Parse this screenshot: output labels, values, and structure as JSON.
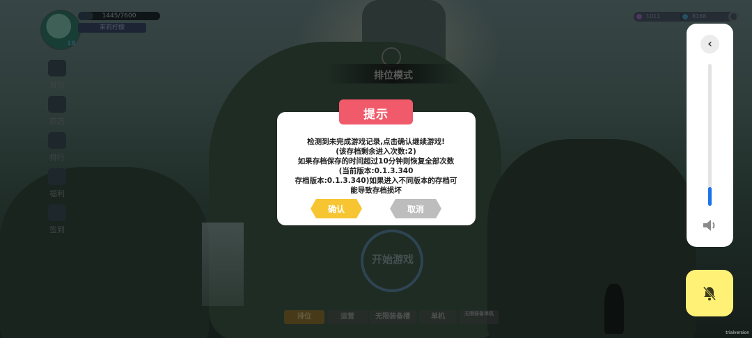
{
  "hud": {
    "hp_text": "1445/7600",
    "hp_fraction": 0.19,
    "player_name": "茉莉柠檬",
    "level": "18",
    "currency_1": "1011",
    "currency_2": "8168"
  },
  "side_menu": [
    {
      "label": "背包"
    },
    {
      "label": "商店"
    },
    {
      "label": "排行"
    },
    {
      "label": "福利"
    },
    {
      "label": "签到"
    }
  ],
  "mode_title": "排位模式",
  "start_label": "开始游戏",
  "tabs": [
    {
      "label": "排位",
      "active": true
    },
    {
      "label": "运营"
    },
    {
      "label": "无限装备槽"
    },
    {
      "label": "单机"
    },
    {
      "label": "无限装备单机"
    }
  ],
  "trial_text": "trialversion",
  "dialog": {
    "title": "提示",
    "lines": [
      "检测到未完成游戏记录,点击确认继续游戏!",
      "(该存档剩余进入次数:2)",
      "如果存档保存的时间超过10分钟则恢复全部次数",
      "(当前版本:0.1.3.340",
      "存档版本:0.1.3.340)如果进入不同版本的存档可",
      "能导致存档损坏"
    ],
    "confirm_label": "确认",
    "cancel_label": "取消"
  },
  "volume": {
    "level": 0.13
  },
  "colors": {
    "dialog_title_bg": "#f05a6a",
    "confirm_bg": "#f7c531",
    "cancel_bg": "#bdbdbd",
    "volume_fill": "#1a73e8",
    "bell_bg": "#fff176"
  }
}
